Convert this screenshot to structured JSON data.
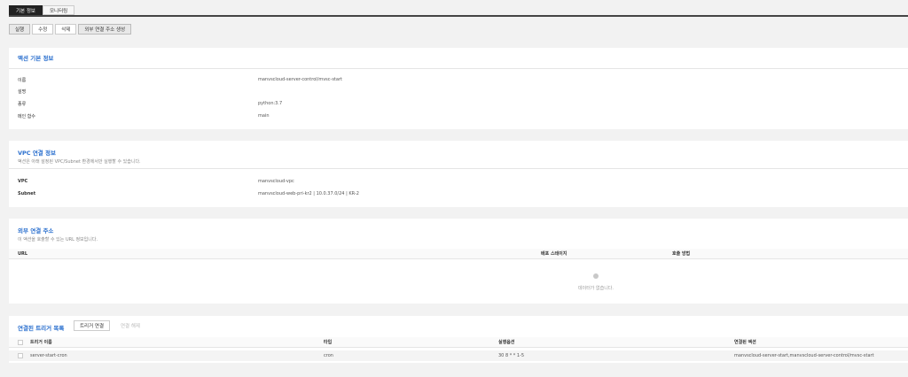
{
  "tabs": [
    {
      "label": "기본 정보",
      "active": true
    },
    {
      "label": "모니터링",
      "active": false
    }
  ],
  "toolbar": {
    "run": "실행",
    "edit": "수정",
    "delete": "삭제",
    "create_url": "외부 연결 주소 생성"
  },
  "action_info": {
    "title": "액션 기본 정보",
    "rows": [
      {
        "key": "이름",
        "value": "manvscloud-server-control/mvsc-start"
      },
      {
        "key": "설명",
        "value": ""
      },
      {
        "key": "종류",
        "value": "python:3.7"
      },
      {
        "key": "메인 함수",
        "value": "main"
      }
    ]
  },
  "vpc_info": {
    "title": "VPC 연결 정보",
    "desc": "액션은 아래 설정된 VPC/Subnet 환경에서만 실행할 수 있습니다.",
    "rows": [
      {
        "key": "VPC",
        "value": "manvscloud-vpc"
      },
      {
        "key": "Subnet",
        "value": "manvscloud-web-pri-kr2 | 10.0.37.0/24 | KR-2"
      }
    ]
  },
  "external_url": {
    "title": "외부 연결 주소",
    "desc": "이 액션을 호출할 수 있는 URL 정보입니다.",
    "columns": [
      "URL",
      "배포 스테이지",
      "호출 방법"
    ],
    "empty_text": "데이터가 없습니다."
  },
  "triggers": {
    "title": "연결된 트리거 목록",
    "connect_button": "트리거 연결",
    "disconnect_button": "연결 해제",
    "columns": [
      "트리거 이름",
      "타입",
      "실행옵션",
      "연결된 액션"
    ],
    "rows": [
      {
        "name": "server-start-cron",
        "type": "cron",
        "option": "30 8 * * 1-5",
        "action": "manvscloud-server-start,manvscloud-server-control/mvsc-start"
      }
    ]
  }
}
